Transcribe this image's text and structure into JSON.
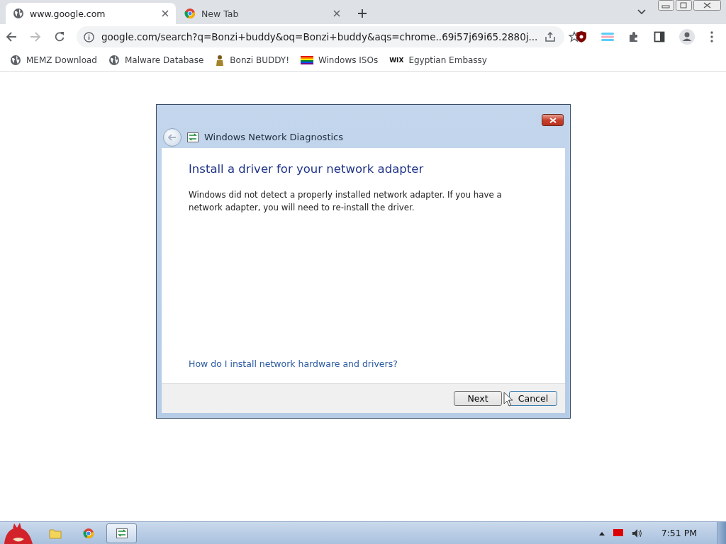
{
  "browser": {
    "tabs": [
      {
        "title": "www.google.com",
        "kind": "globe",
        "selected": true
      },
      {
        "title": "New Tab",
        "kind": "chrome",
        "selected": false
      }
    ],
    "address": "google.com/search?q=Bonzi+buddy&oq=Bonzi+buddy&aqs=chrome..69i57j69i65.2880j...",
    "bookmarks": [
      {
        "label": "MEMZ Download",
        "kind": "globe"
      },
      {
        "label": "Malware Database",
        "kind": "globe"
      },
      {
        "label": "Bonzi BUDDY!",
        "kind": "figure"
      },
      {
        "label": "Windows ISOs",
        "kind": "rainbow"
      },
      {
        "label": "Egyptian Embassy",
        "kind": "text",
        "icon_text": "WIX"
      }
    ]
  },
  "dialog": {
    "title": "Windows Network Diagnostics",
    "heading": "Install a driver for your network adapter",
    "message": "Windows did not detect a properly installed network adapter. If you have a network adapter, you will need to re-install the driver.",
    "link": "How do I install network hardware and drivers?",
    "buttons": [
      {
        "label": "Next",
        "selected": false
      },
      {
        "label": "Cancel",
        "selected": true
      }
    ]
  },
  "taskbar": {
    "apps": [
      {
        "kind": "folder",
        "selected": false
      },
      {
        "kind": "chrome",
        "selected": false
      },
      {
        "kind": "network",
        "selected": true
      }
    ],
    "clock": "7:51 PM"
  }
}
